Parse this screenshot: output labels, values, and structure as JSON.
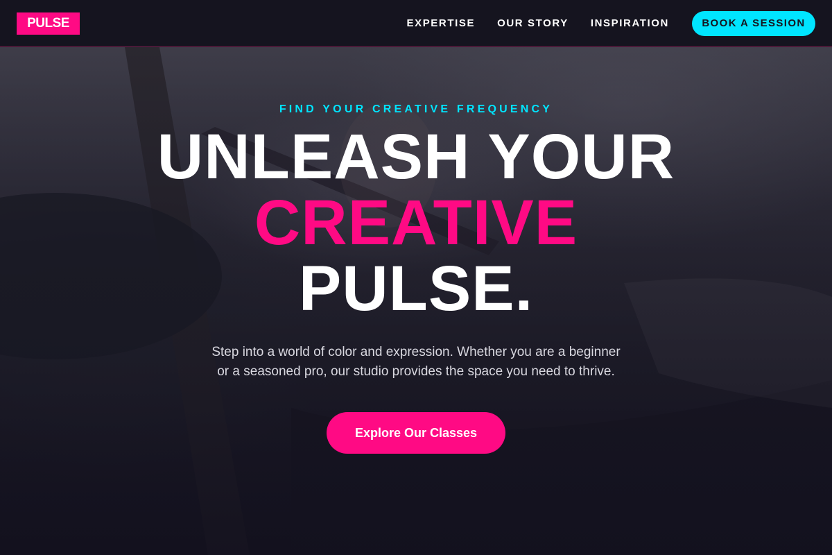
{
  "header": {
    "logo": "PULSE",
    "nav": [
      {
        "label": "EXPERTISE"
      },
      {
        "label": "OUR STORY"
      },
      {
        "label": "INSPIRATION"
      }
    ],
    "cta_label": "BOOK A SESSION"
  },
  "hero": {
    "eyebrow": "FIND YOUR CREATIVE FREQUENCY",
    "headline_line1": "UNLEASH YOUR",
    "headline_line2": "CREATIVE",
    "headline_line3": "PULSE.",
    "subtext_line1": "Step into a world of color and expression. Whether you are a beginner",
    "subtext_line2": "or a seasoned pro, our studio provides the space you need to thrive.",
    "cta_label": "Explore Our Classes",
    "background_icon": "painting-hand-photo"
  },
  "colors": {
    "brand_pink": "#ff0a84",
    "accent_cyan": "#00e5ff",
    "header_bg": "#15141f"
  }
}
